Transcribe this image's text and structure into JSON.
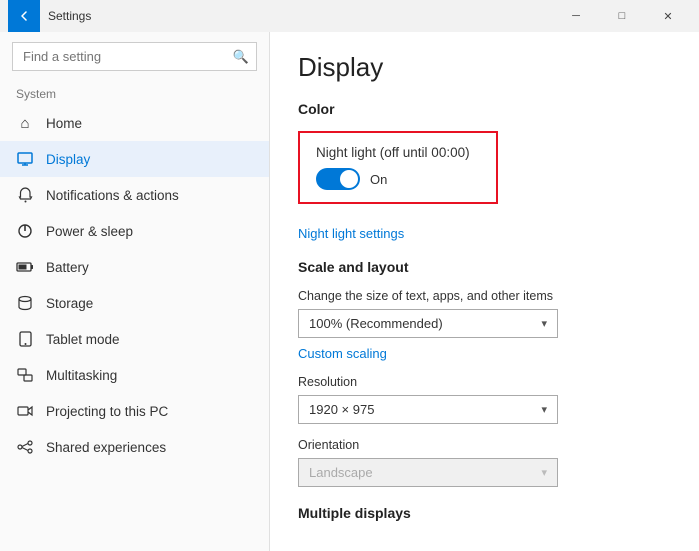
{
  "titleBar": {
    "title": "Settings",
    "minimizeLabel": "─",
    "maximizeLabel": "□",
    "closeLabel": "✕"
  },
  "sidebar": {
    "searchPlaceholder": "Find a setting",
    "systemLabel": "System",
    "navItems": [
      {
        "id": "home",
        "label": "Home",
        "icon": "⌂",
        "active": false
      },
      {
        "id": "display",
        "label": "Display",
        "icon": "🖥",
        "active": true
      },
      {
        "id": "notifications",
        "label": "Notifications & actions",
        "icon": "🔔",
        "active": false
      },
      {
        "id": "power",
        "label": "Power & sleep",
        "icon": "⏻",
        "active": false
      },
      {
        "id": "battery",
        "label": "Battery",
        "icon": "🔋",
        "active": false
      },
      {
        "id": "storage",
        "label": "Storage",
        "icon": "💾",
        "active": false
      },
      {
        "id": "tablet",
        "label": "Tablet mode",
        "icon": "⬜",
        "active": false
      },
      {
        "id": "multitasking",
        "label": "Multitasking",
        "icon": "⬛",
        "active": false
      },
      {
        "id": "projecting",
        "label": "Projecting to this PC",
        "icon": "✦",
        "active": false
      },
      {
        "id": "shared",
        "label": "Shared experiences",
        "icon": "↗",
        "active": false
      }
    ]
  },
  "main": {
    "pageTitle": "Display",
    "colorSection": {
      "title": "Color",
      "nightLightLabel": "Night light (off until 00:00)",
      "toggleState": "On",
      "nightLightSettings": "Night light settings"
    },
    "scaleSection": {
      "title": "Scale and layout",
      "changeSizeLabel": "Change the size of text, apps, and other items",
      "scaleValue": "100% (Recommended)",
      "customScaling": "Custom scaling",
      "resolutionLabel": "Resolution",
      "resolutionValue": "1920 × 975",
      "orientationLabel": "Orientation",
      "orientationValue": "Landscape"
    },
    "multipleDisplays": {
      "title": "Multiple displays"
    }
  }
}
